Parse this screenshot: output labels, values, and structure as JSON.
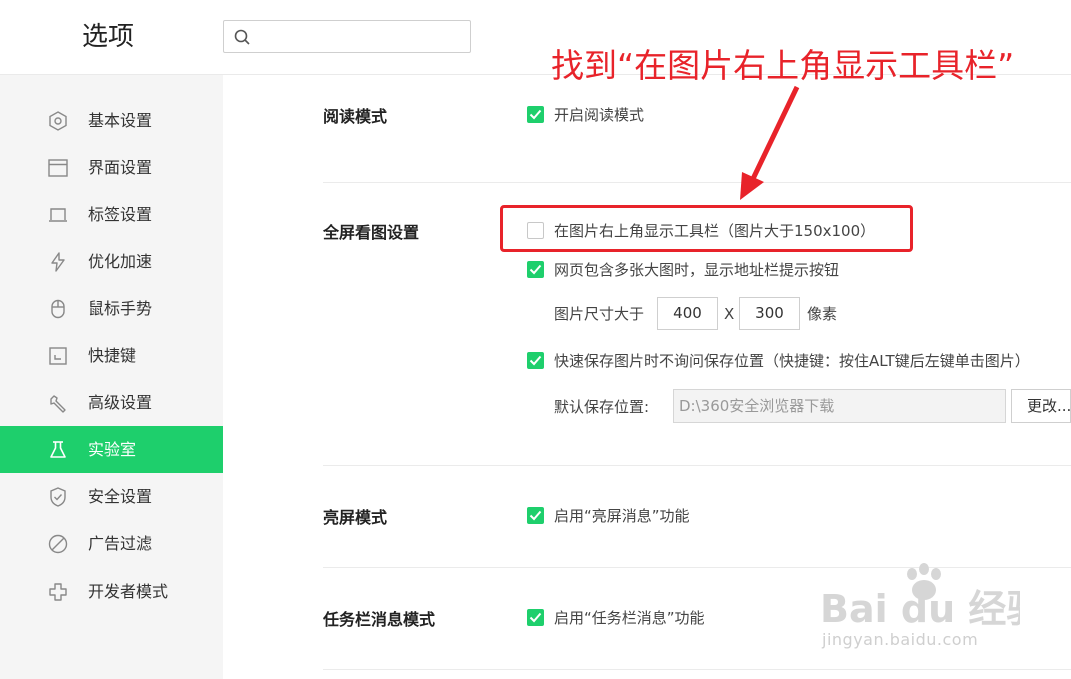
{
  "header": {
    "title": "选项",
    "search": {
      "value": "",
      "placeholder": ""
    }
  },
  "sidebar": {
    "items": [
      {
        "label": "基本设置",
        "icon": "hexagon-icon",
        "active": false
      },
      {
        "label": "界面设置",
        "icon": "window-icon",
        "active": false
      },
      {
        "label": "标签设置",
        "icon": "tab-icon",
        "active": false
      },
      {
        "label": "优化加速",
        "icon": "lightning-icon",
        "active": false
      },
      {
        "label": "鼠标手势",
        "icon": "mouse-icon",
        "active": false
      },
      {
        "label": "快捷键",
        "icon": "keyboard-shortcut-icon",
        "active": false
      },
      {
        "label": "高级设置",
        "icon": "wrench-icon",
        "active": false
      },
      {
        "label": "实验室",
        "icon": "flask-icon",
        "active": true
      },
      {
        "label": "安全设置",
        "icon": "shield-icon",
        "active": false
      },
      {
        "label": "广告过滤",
        "icon": "block-icon",
        "active": false
      },
      {
        "label": "开发者模式",
        "icon": "puzzle-icon",
        "active": false
      }
    ]
  },
  "main": {
    "reading": {
      "title": "阅读模式",
      "option": {
        "label": "开启阅读模式",
        "checked": true
      }
    },
    "fullscreen": {
      "title": "全屏看图设置",
      "toolbar_option": {
        "label": "在图片右上角显示工具栏（图片大于150x100）",
        "checked": false
      },
      "address_option": {
        "label": "网页包含多张大图时，显示地址栏提示按钮",
        "checked": true
      },
      "size_label": "图片尺寸大于",
      "width": "400",
      "x_label": "X",
      "height": "300",
      "unit": "像素",
      "quicksave_option": {
        "label": "快速保存图片时不询问保存位置（快捷键：按住ALT键后左键单击图片）",
        "checked": true
      },
      "save_path_label": "默认保存位置:",
      "save_path": "D:\\360安全浏览器下载",
      "change_button": "更改..."
    },
    "brightscreen": {
      "title": "亮屏模式",
      "option": {
        "label": "启用“亮屏消息”功能",
        "checked": true
      }
    },
    "taskbar": {
      "title": "任务栏消息模式",
      "option": {
        "label": "启用“任务栏消息”功能",
        "checked": true
      }
    }
  },
  "annotation": {
    "text": "找到“在图片右上角显示工具栏”",
    "color": "#e8232a"
  },
  "watermark": {
    "logo": "Bai du 经验",
    "url": "jingyan.baidu.com"
  },
  "colors": {
    "accent": "#1ecf6c",
    "sidebar_bg": "#f5f5f5"
  }
}
